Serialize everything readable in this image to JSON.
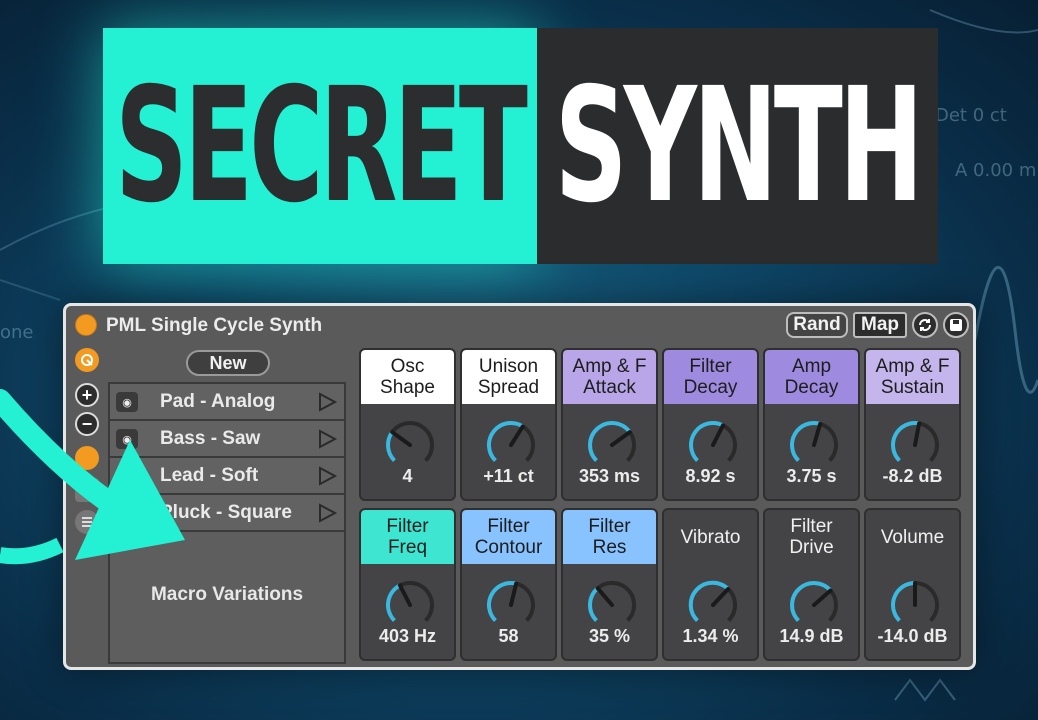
{
  "banner": {
    "word_left": "SECRET",
    "word_right": "SYNTH"
  },
  "background_text": [
    "Det 0 ct",
    "A 0.00 m",
    "one"
  ],
  "device": {
    "title": "PML Single Cycle Synth",
    "buttons": {
      "rand": "Rand",
      "map": "Map"
    },
    "new_label": "New",
    "side_buttons": {
      "plus": "+",
      "minus": "−"
    },
    "presets": [
      {
        "label": "Pad - Analog"
      },
      {
        "label": "Bass - Saw"
      },
      {
        "label": "Lead - Soft"
      },
      {
        "label": "Pluck - Square"
      }
    ],
    "macro_label": "Macro Variations",
    "knobs": [
      {
        "name": "Osc\nShape",
        "value": "4",
        "level": 0.3,
        "header_color": "#ffffff",
        "text_color": "#1d1d1d"
      },
      {
        "name": "Unison\nSpread",
        "value": "+11 ct",
        "level": 0.62,
        "header_color": "#ffffff",
        "text_color": "#1d1d1d"
      },
      {
        "name": "Amp & F\nAttack",
        "value": "353 ms",
        "level": 0.7,
        "header_color": "#b8a6e8",
        "text_color": "#1d1d1d"
      },
      {
        "name": "Filter\nDecay",
        "value": "8.92 s",
        "level": 0.6,
        "header_color": "#9e8be0",
        "text_color": "#1d1d1d"
      },
      {
        "name": "Amp\nDecay",
        "value": "3.75 s",
        "level": 0.56,
        "header_color": "#9e8be0",
        "text_color": "#1d1d1d"
      },
      {
        "name": "Amp & F\nSustain",
        "value": "-8.2 dB",
        "level": 0.54,
        "header_color": "#c4b6ec",
        "text_color": "#1d1d1d"
      },
      {
        "name": "Filter\nFreq",
        "value": "403 Hz",
        "level": 0.4,
        "header_color": "#3ee6d2",
        "text_color": "#1d1d1d"
      },
      {
        "name": "Filter\nContour",
        "value": "58",
        "level": 0.55,
        "header_color": "#88c3ff",
        "text_color": "#1d1d1d"
      },
      {
        "name": "Filter\nRes",
        "value": "35 %",
        "level": 0.35,
        "header_color": "#88c3ff",
        "text_color": "#1d1d1d"
      },
      {
        "name": "Vibrato",
        "value": "1.34 %",
        "level": 0.66,
        "header_color": "#444446",
        "text_color": "#f0f0f0"
      },
      {
        "name": "Filter\nDrive",
        "value": "14.9 dB",
        "level": 0.68,
        "header_color": "#444446",
        "text_color": "#f0f0f0"
      },
      {
        "name": "Volume",
        "value": "-14.0 dB",
        "level": 0.5,
        "header_color": "#444446",
        "text_color": "#f0f0f0"
      }
    ]
  },
  "colors": {
    "accent_cyan": "#24f0d4",
    "knob_arc": "#3ab8e0",
    "power": "#f39a21"
  }
}
